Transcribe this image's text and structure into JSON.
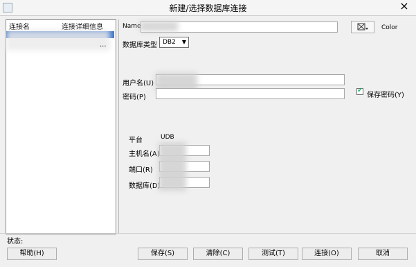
{
  "window": {
    "title": "新建/选择数据库连接",
    "close_symbol": "×"
  },
  "left_list": {
    "columns": [
      "连接名",
      "连接详细信息"
    ],
    "rows": [
      {
        "cell1": "",
        "cell2": ""
      },
      {
        "cell1": "",
        "cell2": "..."
      }
    ]
  },
  "form": {
    "name_label": "Name",
    "name_value": "",
    "color_label": "Color",
    "db_type_label": "数据库类型",
    "db_type_value": "DB2",
    "username_label": "用户名(U)",
    "username_value": "",
    "password_label": "密码(P)",
    "password_value": "",
    "save_password_label": "保存密码(Y)",
    "save_password_checked": true,
    "platform_label": "平台",
    "platform_value": "UDB",
    "host_label": "主机名(A)",
    "host_value": "",
    "port_label": "端口(R)",
    "port_value": "",
    "database_label": "数据库(D)",
    "database_value": ""
  },
  "footer": {
    "status_label": "状态:",
    "help_button": "帮助(H)",
    "save_button": "保存(S)",
    "delete_button": "清除(C)",
    "test_button": "测试(T)",
    "connect_button": "连接(O)",
    "cancel_button": "取消"
  }
}
